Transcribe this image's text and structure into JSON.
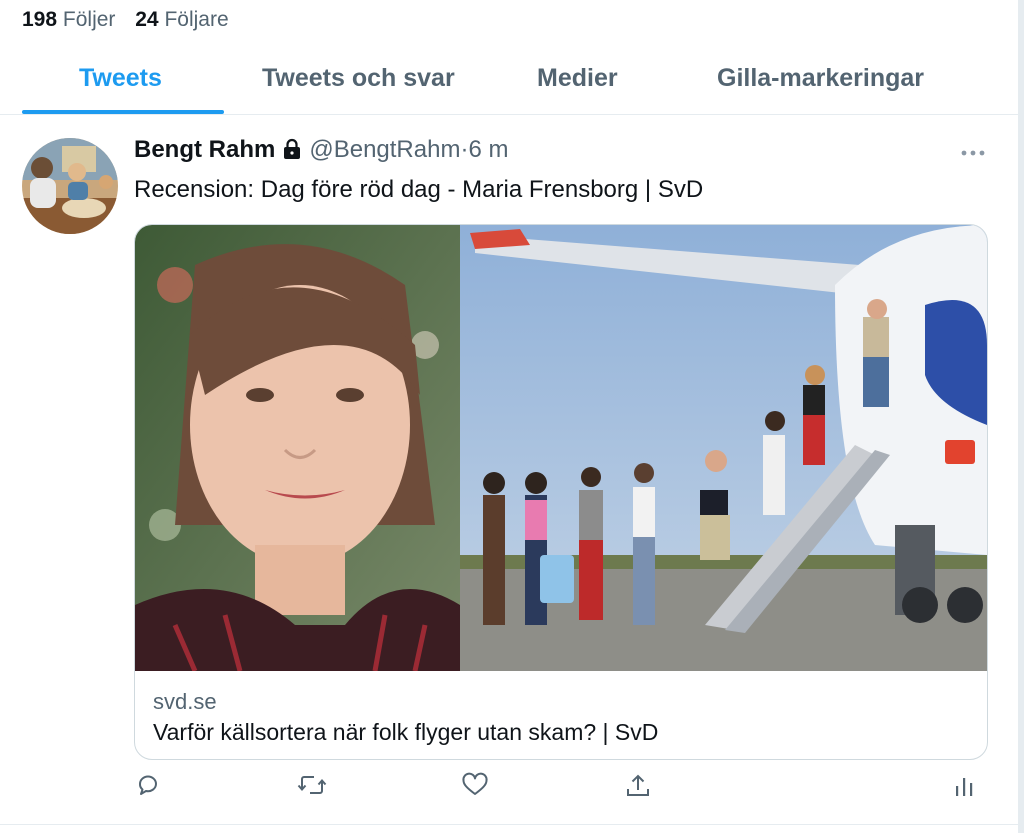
{
  "profile_stats": {
    "following_count": "198",
    "following_label": "Följer",
    "followers_count": "24",
    "followers_label": "Följare"
  },
  "tabs": [
    {
      "label": "Tweets",
      "active": true
    },
    {
      "label": "Tweets och svar",
      "active": false
    },
    {
      "label": "Medier",
      "active": false
    },
    {
      "label": "Gilla-markeringar",
      "active": false
    }
  ],
  "tweet": {
    "author_name": "Bengt Rahm",
    "handle": "@BengtRahm",
    "separator": "·",
    "time": "6 m",
    "text": "Recension: Dag före röd dag - Maria Frensborg | SvD",
    "card": {
      "domain": "svd.se",
      "title": "Varför källsortera när folk flyger utan skam? | SvD"
    },
    "actions": [
      "reply-icon",
      "retweet-icon",
      "like-icon",
      "share-icon",
      "analytics-icon"
    ]
  },
  "colors": {
    "accent": "#1d9bf0",
    "secondary_text": "#536471",
    "border": "#cfd9de"
  }
}
